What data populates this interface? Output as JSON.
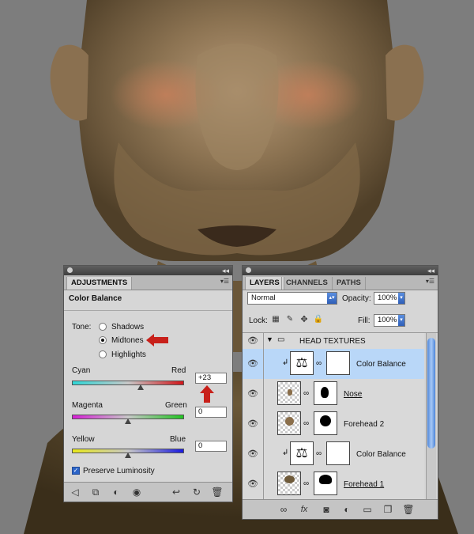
{
  "adjustments_panel": {
    "tab_label": "ADJUSTMENTS",
    "title": "Color Balance",
    "tone_label": "Tone:",
    "tones": [
      {
        "label": "Shadows",
        "selected": false
      },
      {
        "label": "Midtones",
        "selected": true
      },
      {
        "label": "Highlights",
        "selected": false
      }
    ],
    "sliders": [
      {
        "left_label": "Cyan",
        "right_label": "Red",
        "value": "+23",
        "level": 23
      },
      {
        "left_label": "Magenta",
        "right_label": "Green",
        "value": "0",
        "level": 0
      },
      {
        "left_label": "Yellow",
        "right_label": "Blue",
        "value": "0",
        "level": 0
      }
    ],
    "preserve_luminosity_label": "Preserve Luminosity",
    "preserve_luminosity_checked": true,
    "annotation_color": "#c8201a"
  },
  "layers_panel": {
    "tabs": [
      "LAYERS",
      "CHANNELS",
      "PATHS"
    ],
    "blend_mode": "Normal",
    "opacity_label": "Opacity:",
    "opacity_value": "100%",
    "lock_label": "Lock:",
    "fill_label": "Fill:",
    "fill_value": "100%",
    "group_name": "HEAD TEXTURES",
    "layers": [
      {
        "name": "Color Balance",
        "type": "adjustment",
        "selected": true,
        "clipped": true
      },
      {
        "name": "Nose",
        "type": "pixel",
        "selected": false,
        "underline": true
      },
      {
        "name": "Forehead 2",
        "type": "pixel",
        "selected": false
      },
      {
        "name": "Color Balance",
        "type": "adjustment",
        "selected": false,
        "clipped": true
      },
      {
        "name": "Forehead 1",
        "type": "pixel",
        "selected": false,
        "underline": true
      }
    ],
    "selection_color": "#b9d7f8"
  }
}
